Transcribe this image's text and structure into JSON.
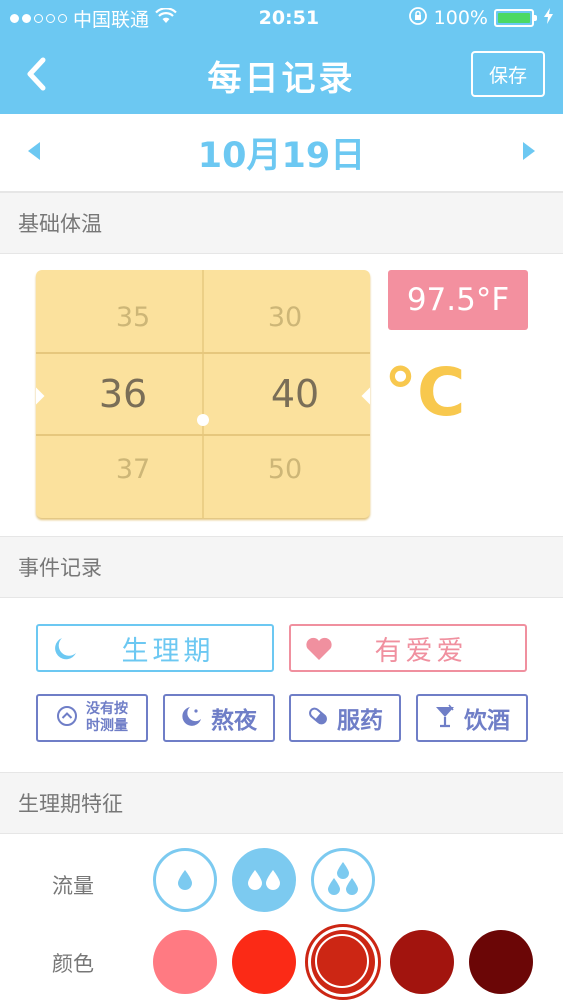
{
  "status_bar": {
    "carrier": "中国联通",
    "time": "20:51",
    "battery": "100%",
    "battery_level": 1.0,
    "signal_bars": 2,
    "icons": [
      "wifi-icon",
      "orientation-lock-icon",
      "battery-icon",
      "charging-icon"
    ]
  },
  "nav": {
    "title": "每日记录",
    "save_label": "保存",
    "back_icon": "chevron-left-icon"
  },
  "date": {
    "label": "10月19日"
  },
  "sections": {
    "basal_temp": "基础体温",
    "events": "事件记录",
    "period_features": "生理期特征"
  },
  "temperature": {
    "integer_column": [
      "35",
      "36",
      "37"
    ],
    "decimal_column": [
      "30",
      "40",
      "50"
    ],
    "fahrenheit": "97.5°F",
    "unit": "°C"
  },
  "events": {
    "period": "生理期",
    "love": "有爱爱",
    "no_measure": "没有按时测量",
    "no_measure_line1": "没有按",
    "no_measure_line2": "时测量",
    "stay_up": "熬夜",
    "medicine": "服药",
    "drinking": "饮酒"
  },
  "features": {
    "flow_label": "流量",
    "color_label": "颜色",
    "flow_levels": [
      {
        "drops": 1,
        "selected": false
      },
      {
        "drops": 2,
        "selected": true
      },
      {
        "drops": 3,
        "selected": false
      }
    ],
    "colors": [
      {
        "hex": "#ff7a82",
        "selected": false
      },
      {
        "hex": "#fb2a16",
        "selected": false
      },
      {
        "hex": "#cc2614",
        "selected": true
      },
      {
        "hex": "#a2140e",
        "selected": false
      },
      {
        "hex": "#6b0606",
        "selected": false
      }
    ]
  },
  "theme": {
    "nav_blue": "#6cc8f2",
    "pink": "#f3909f",
    "picker_yellow": "#fbe19d",
    "celsius_yellow": "#f8c84e",
    "indigo": "#6f7ec7"
  }
}
